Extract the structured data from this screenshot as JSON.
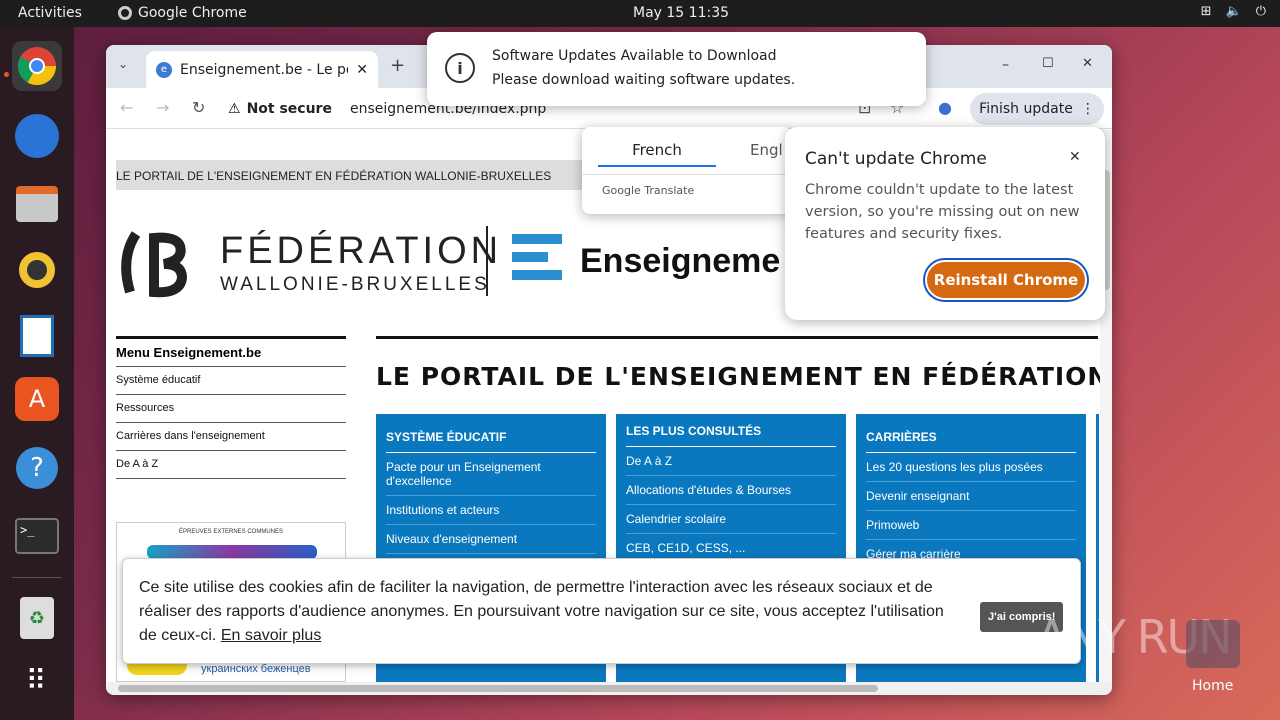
{
  "topbar": {
    "activities": "Activities",
    "app_name": "Google Chrome",
    "clock": "May 15  11:35"
  },
  "tab": {
    "title": "Enseignement.be - Le portail",
    "new_tab": "+"
  },
  "address": {
    "security": "Not secure",
    "url": "enseignement.be/index.php"
  },
  "toolbar": {
    "finish_update": "Finish update"
  },
  "page": {
    "gray_header": "LE PORTAIL DE L'ENSEIGNEMENT EN FÉDÉRATION WALLONIE-BRUXELLES",
    "logo_line1": "FÉDÉRATION",
    "logo_line2": "WALLONIE-BRUXELLES",
    "logo_right": "Enseigneme",
    "menu_title": "Menu Enseignement.be",
    "menu_items": [
      "Système éducatif",
      "Ressources",
      "Carrières dans l'enseignement",
      "De A à Z"
    ],
    "big_title": "LE PORTAIL DE L'ENSEIGNEMENT EN FÉDÉRATION WALL",
    "col1": {
      "title": "SYSTÈME ÉDUCATIF",
      "items": [
        "Pacte pour un Enseignement d'excellence",
        "Institutions et acteurs",
        "Niveaux d'enseignement"
      ]
    },
    "col2": {
      "title": "LES PLUS CONSULTÉS",
      "items": [
        "De A à Z",
        "Allocations d'études & Bourses",
        "Calendrier scolaire",
        "CEB, CE1D, CESS, ..."
      ]
    },
    "col3": {
      "title": "CARRIÈRES",
      "items": [
        "Les 20 questions les plus posées",
        "Devenir enseignant",
        "Primoweb",
        "Gérer ma carrière"
      ]
    },
    "banner_small": "ÉPREUVES EXTERNES COMMUNES",
    "banner_bottom": "украинских беженцев"
  },
  "notification": {
    "line1": "Software Updates Available to Download",
    "line2": "Please download waiting software updates."
  },
  "translate": {
    "tab1": "French",
    "tab2": "Engl",
    "brand": "Google Translate"
  },
  "update_popup": {
    "title": "Can't update Chrome",
    "body": "Chrome couldn't update to the latest version, so you're missing out on new features and security fixes.",
    "button": "Reinstall Chrome"
  },
  "cookie": {
    "text": "Ce site utilise des cookies afin de faciliter la navigation, de permettre l'interaction avec les réseaux sociaux et de réaliser des rapports d'audience anonymes. En poursuivant votre navigation sur ce site, vous acceptez l'utilisation de ceux-ci.",
    "link": "En savoir plus",
    "accept": "J'ai compris!"
  },
  "desktop": {
    "home_label": "Home"
  },
  "watermark": "ANY RUN",
  "colors": {
    "chrome_orange": "#d5690f",
    "fwb_blue": "#2a8fd0",
    "col_blue": "#0a78bf"
  }
}
